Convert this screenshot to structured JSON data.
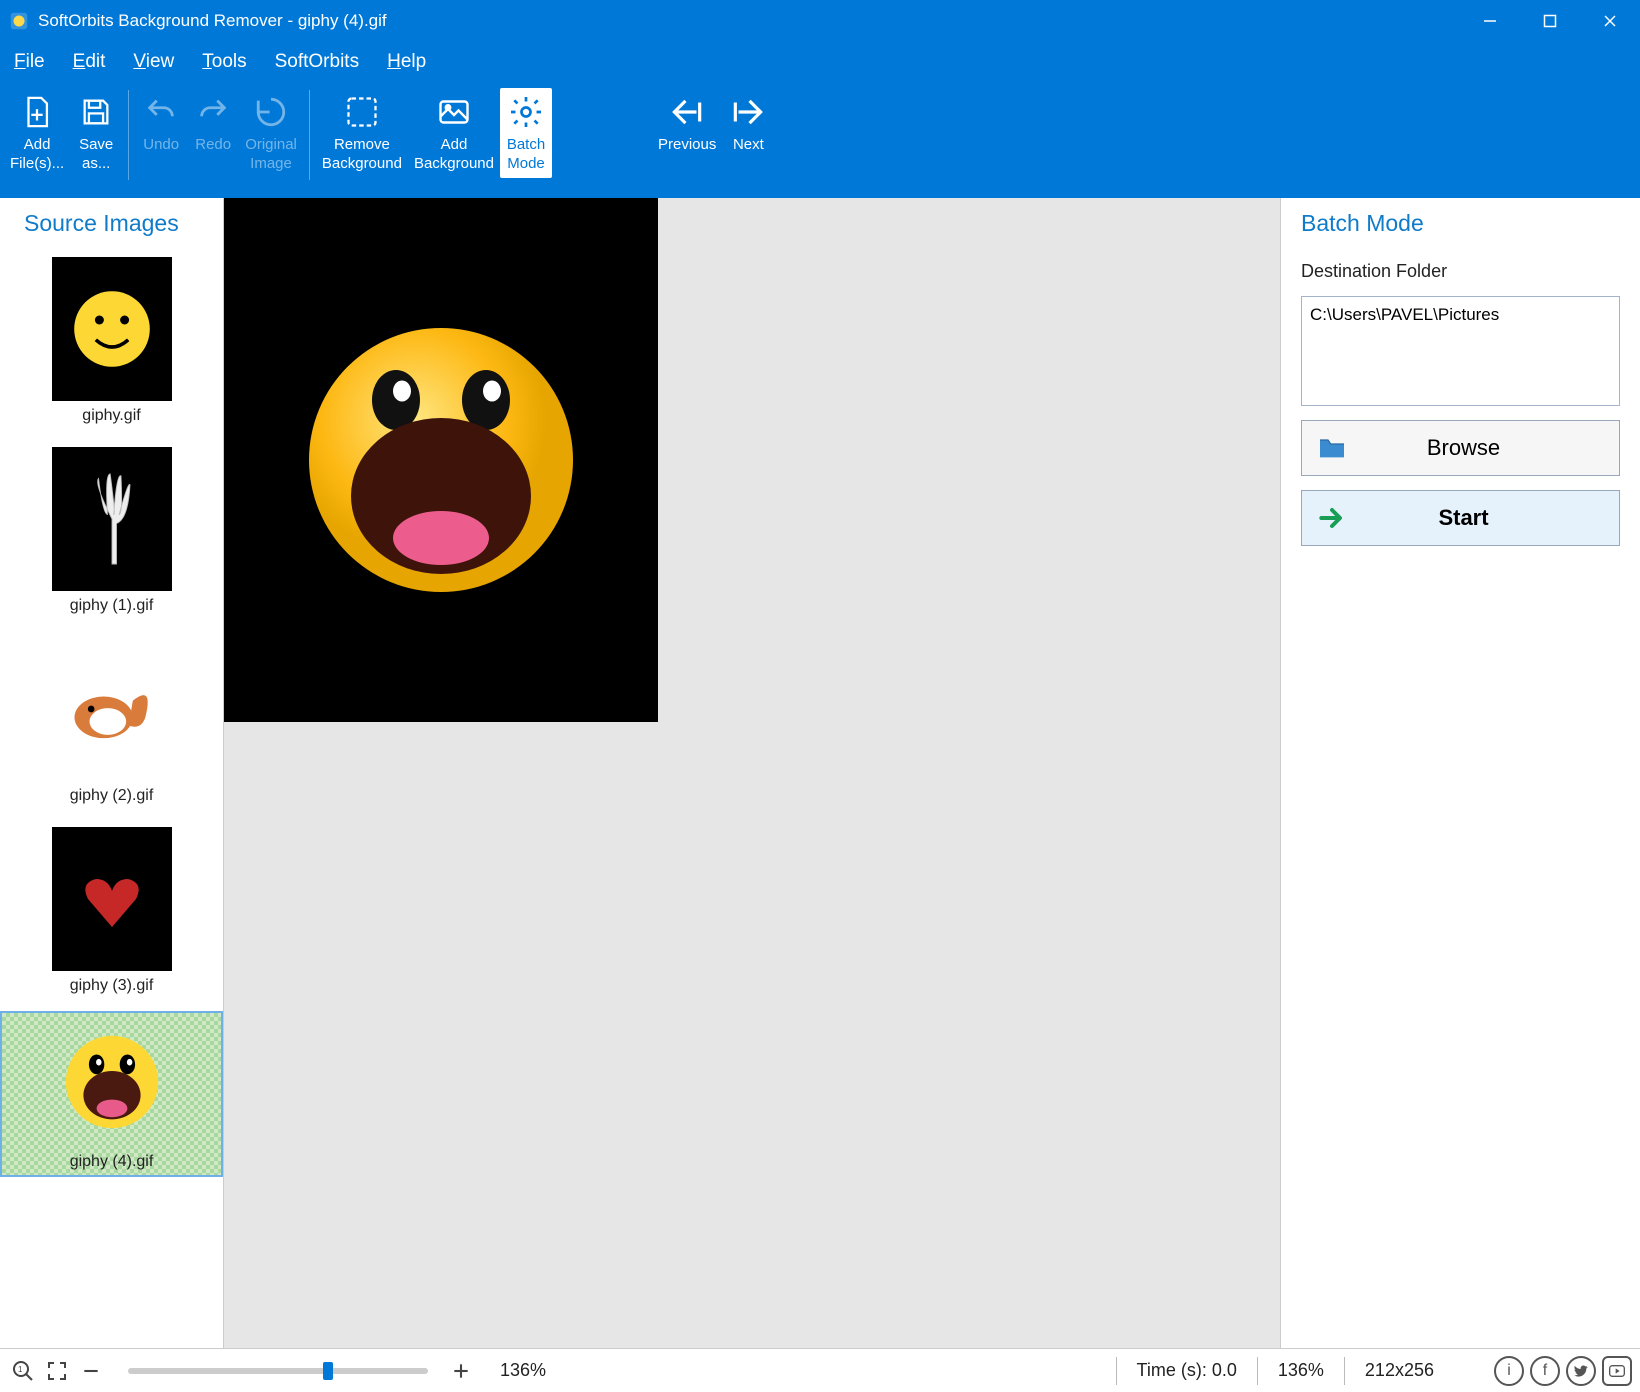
{
  "title": "SoftOrbits Background Remover - giphy (4).gif",
  "menu": {
    "file": "File",
    "edit": "Edit",
    "view": "View",
    "tools": "Tools",
    "softorbits": "SoftOrbits",
    "help": "Help"
  },
  "toolbar": {
    "add_files": "Add File(s)...",
    "save_as": "Save as...",
    "undo": "Undo",
    "redo": "Redo",
    "original": "Original Image",
    "remove_bg": "Remove Background",
    "add_bg": "Add Background",
    "batch_mode": "Batch Mode",
    "previous": "Previous",
    "next": "Next"
  },
  "left_panel_title": "Source Images",
  "thumbs": [
    {
      "label": "giphy.gif"
    },
    {
      "label": "giphy (1).gif"
    },
    {
      "label": "giphy (2).gif"
    },
    {
      "label": "giphy (3).gif"
    },
    {
      "label": "giphy (4).gif"
    }
  ],
  "right_panel": {
    "title": "Batch Mode",
    "dest_label": "Destination Folder",
    "dest_value": "C:\\Users\\PAVEL\\Pictures",
    "browse": "Browse",
    "start": "Start"
  },
  "statusbar": {
    "zoom_pct": "136%",
    "time": "Time (s): 0.0",
    "zoom_pct2": "136%",
    "dims": "212x256"
  }
}
